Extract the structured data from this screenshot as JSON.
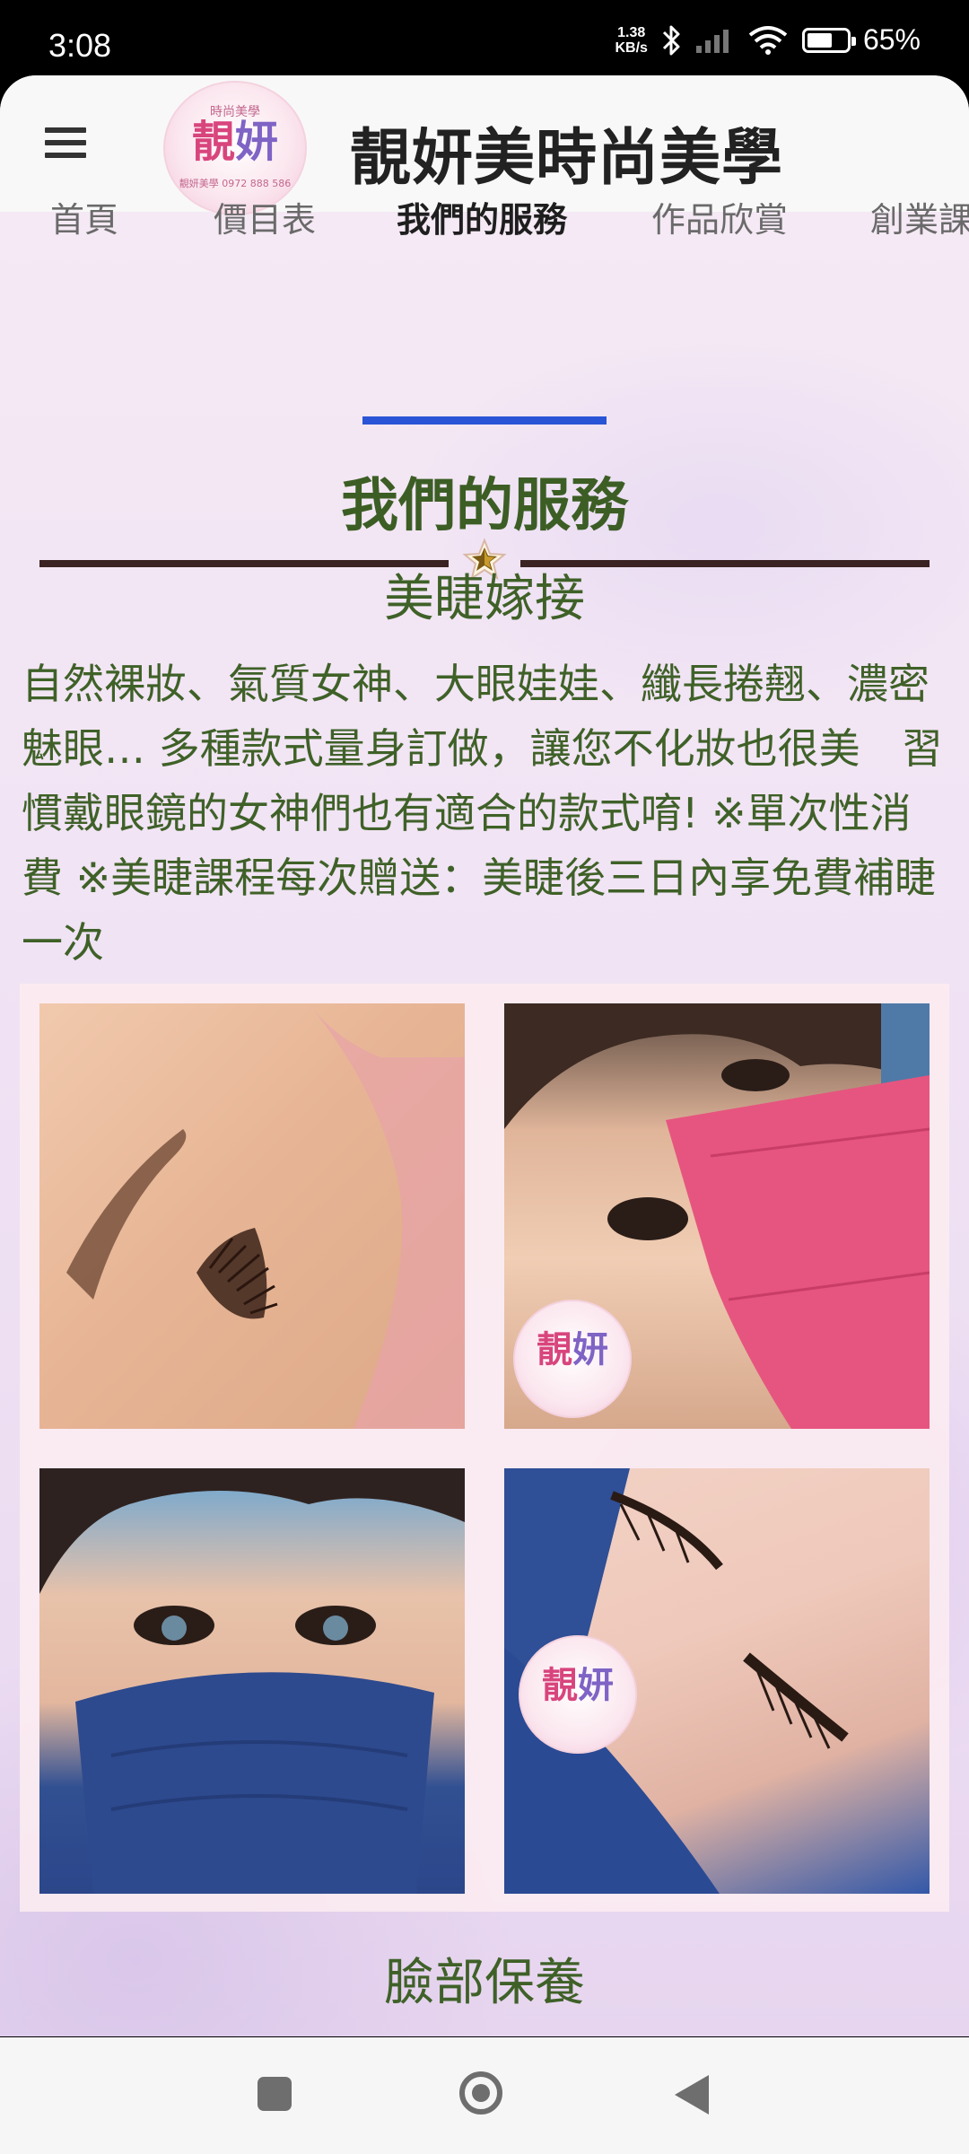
{
  "status_bar": {
    "time": "3:08",
    "net_speed_value": "1.38",
    "net_speed_unit": "KB/s",
    "battery_percent": "65%",
    "battery_level": 0.65
  },
  "app_bar": {
    "menu_icon": "hamburger-icon",
    "logo": {
      "top_text": "時尚美學",
      "main_left": "靚",
      "main_right": "妍",
      "sub_text": "靚妍美學 0972 888 586"
    },
    "title": "靚妍美時尚美學"
  },
  "tabs": [
    {
      "label": "首頁"
    },
    {
      "label": "價目表"
    },
    {
      "label": "我們的服務",
      "active": true
    },
    {
      "label": "作品欣賞"
    },
    {
      "label": "創業課"
    }
  ],
  "section": {
    "title": "我們的服務",
    "divider_icon": "star-icon"
  },
  "service": {
    "heading": "美睫嫁接",
    "description": "自然裸妝、氣質女神、大眼娃娃、纖長捲翹、濃密魅眼… 多種款式量身訂做，讓您不化妝也很美　習慣戴眼鏡的女神們也有適合的款式唷! ※單次性消費 ※美睫課程每次贈送：美睫後三日內享免費補睫一次"
  },
  "gallery": {
    "photos": [
      {
        "subject": "eyelash-extension-closeup"
      },
      {
        "subject": "woman-pink-mask"
      },
      {
        "subject": "woman-blue-mask"
      },
      {
        "subject": "eyelash-closed-eye"
      }
    ],
    "watermark": {
      "left": "靚",
      "right": "妍"
    }
  },
  "next_section": {
    "heading": "臉部保養"
  },
  "nav_bar": {
    "recents_icon": "square-recents-icon",
    "home_icon": "circle-home-icon",
    "back_icon": "triangle-back-icon"
  },
  "colors": {
    "accent_tab": "#2a54d6",
    "heading_green": "#3c5e25",
    "text_green": "#3f6128",
    "divider": "#3b2323"
  }
}
